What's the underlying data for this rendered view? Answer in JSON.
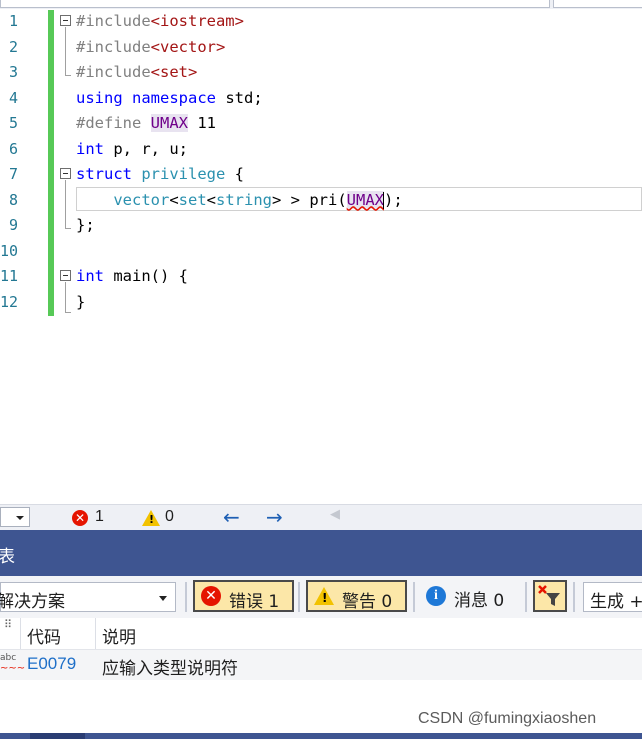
{
  "editor": {
    "line_numbers": [
      "1",
      "2",
      "3",
      "4",
      "5",
      "6",
      "7",
      "8",
      "9",
      "10",
      "11",
      "12"
    ],
    "lines": [
      [
        {
          "t": "#include",
          "c": "pp"
        },
        {
          "t": "<iostream>",
          "c": "inc"
        }
      ],
      [
        {
          "t": "#include",
          "c": "pp"
        },
        {
          "t": "<vector>",
          "c": "inc"
        }
      ],
      [
        {
          "t": "#include",
          "c": "pp"
        },
        {
          "t": "<set>",
          "c": "inc"
        }
      ],
      [
        {
          "t": "using",
          "c": "kw"
        },
        {
          "t": " "
        },
        {
          "t": "namespace",
          "c": "kw"
        },
        {
          "t": " std;"
        }
      ],
      [
        {
          "t": "#define",
          "c": "pp"
        },
        {
          "t": " "
        },
        {
          "t": "UMAX",
          "c": "macro"
        },
        {
          "t": " 11"
        }
      ],
      [
        {
          "t": "int",
          "c": "kw"
        },
        {
          "t": " p, r, u;"
        }
      ],
      [
        {
          "t": "struct",
          "c": "kw"
        },
        {
          "t": " "
        },
        {
          "t": "privilege",
          "c": "ty"
        },
        {
          "t": " {"
        }
      ],
      [
        {
          "t": "    vector",
          "c": "ty"
        },
        {
          "t": "<"
        },
        {
          "t": "set",
          "c": "ty"
        },
        {
          "t": "<"
        },
        {
          "t": "string",
          "c": "ty"
        },
        {
          "t": "> > pri("
        },
        {
          "t": "UMAX",
          "c": "macro sq"
        },
        {
          "t": "CARET"
        },
        {
          "t": ");"
        }
      ],
      [
        {
          "t": "};"
        }
      ],
      [
        {
          "t": ""
        }
      ],
      [
        {
          "t": "int",
          "c": "kw"
        },
        {
          "t": " main() {"
        }
      ],
      [
        {
          "t": "}"
        }
      ]
    ]
  },
  "statusbar": {
    "error_count": "1",
    "warning_count": "0",
    "nav_back": "←",
    "nav_forward": "→",
    "nav_disabled": "◀"
  },
  "panel": {
    "title": "表",
    "scope": "解决方案",
    "errors_btn": "错误 1",
    "warnings_btn": "警告 0",
    "messages_btn": "消息 0",
    "build_select": "生成 +"
  },
  "list": {
    "columns": [
      "代码",
      "说明"
    ],
    "rows": [
      {
        "code": "E0079",
        "description": "应输入类型说明符",
        "icon_text": "abc"
      }
    ]
  },
  "watermark": "CSDN @fumingxiaoshen",
  "colors": {
    "panel_title_bg": "#3e5591",
    "change_bar": "#57c957",
    "error_red": "#e51400",
    "warning_yellow": "#f2c200",
    "info_blue": "#1e78d7",
    "link_blue": "#1e6fc8"
  }
}
